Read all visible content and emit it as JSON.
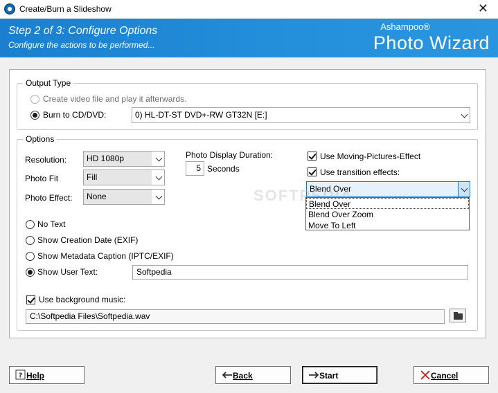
{
  "window": {
    "title": "Create/Burn a Slideshow"
  },
  "banner": {
    "step_title": "Step 2 of 3: Configure Options",
    "step_subtitle": "Configure the actions to be performed...",
    "brand_small": "Ashampoo®",
    "brand_big": "Photo Wizard",
    "color": "#1f8ad6"
  },
  "output_type": {
    "legend": "Output Type",
    "option_video": "Create video file and play it afterwards.",
    "option_burn": "Burn to CD/DVD:",
    "drive": "0) HL-DT-ST DVD+-RW GT32N [E:]"
  },
  "options": {
    "legend": "Options",
    "resolution_label": "Resolution:",
    "resolution_value": "HD 1080p",
    "photo_fit_label": "Photo Fit",
    "photo_fit_value": "Fill",
    "photo_effect_label": "Photo Effect:",
    "photo_effect_value": "None",
    "duration_label": "Photo Display Duration:",
    "duration_value": "5",
    "duration_unit": "Seconds",
    "moving_pictures_label": "Use Moving-Pictures-Effect",
    "transition_label": "Use transition effects:",
    "transition_value": "Blend Over",
    "transition_options": [
      "Blend Over",
      "Blend Over Zoom",
      "Move To Left"
    ],
    "caption_no_text": "No Text",
    "caption_creation_date": "Show Creation Date (EXIF)",
    "caption_metadata": "Show Metadata Caption (IPTC/EXIF)",
    "caption_user_text": "Show User Text:",
    "user_text_value": "Softpedia",
    "music_label": "Use background music:",
    "music_path": "C:\\Softpedia Files\\Softpedia.wav"
  },
  "buttons": {
    "help": "Help",
    "back": "Back",
    "start": "Start",
    "cancel": "Cancel"
  },
  "watermark": "SOFTPEDIA"
}
